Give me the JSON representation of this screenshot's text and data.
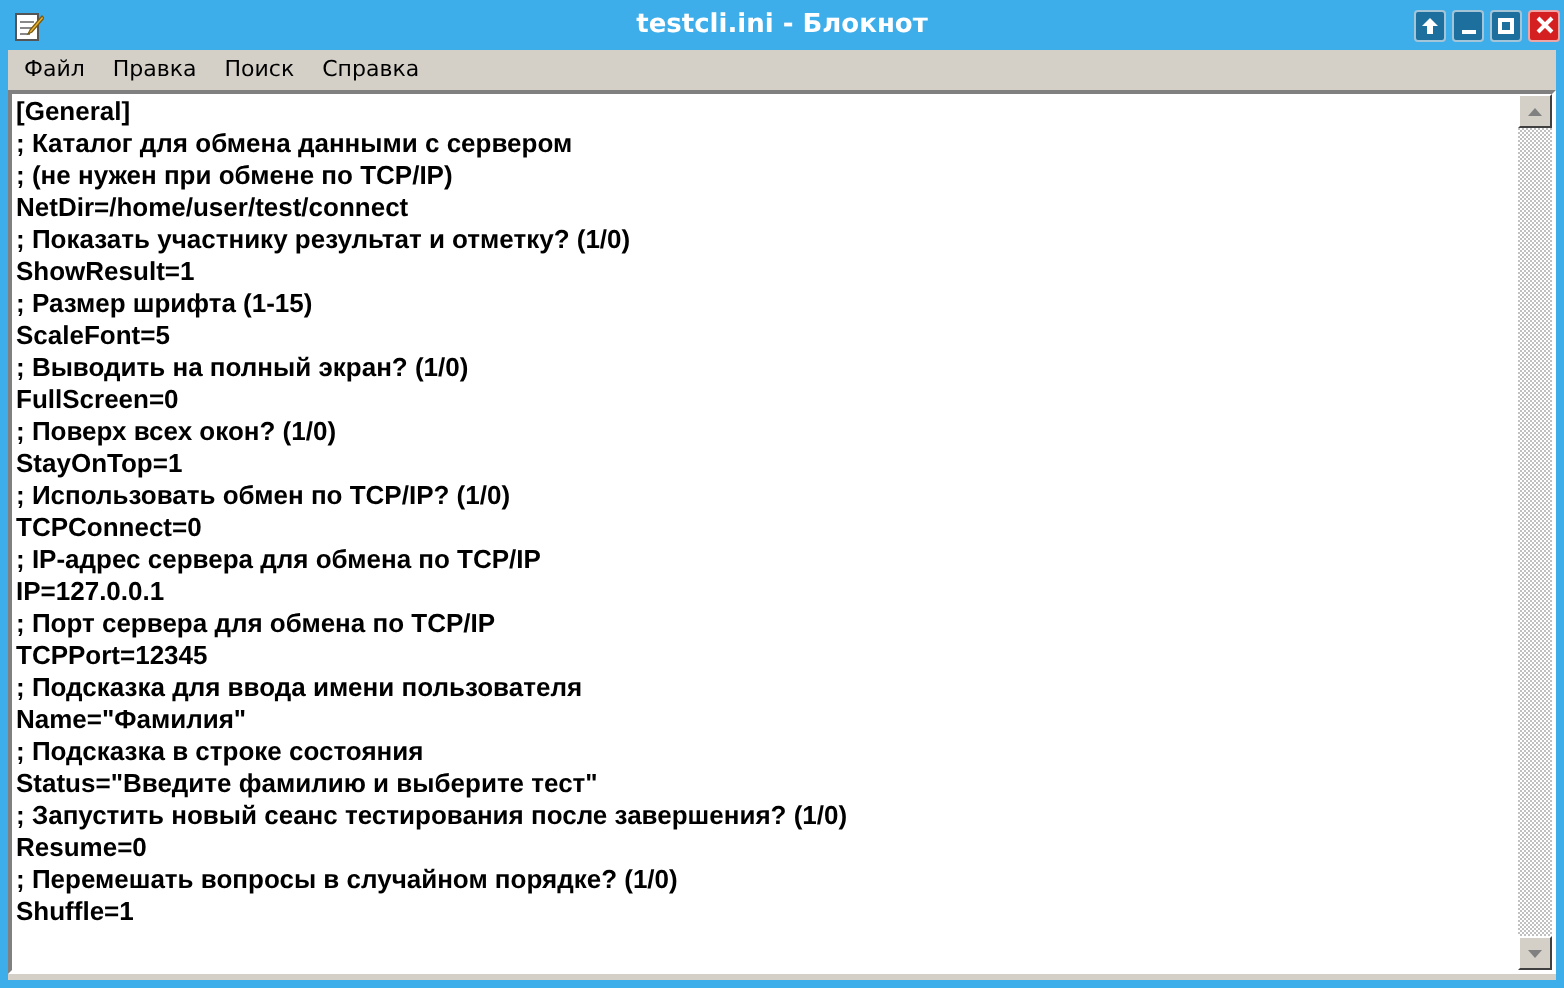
{
  "window": {
    "title": "testcli.ini - Блокнот"
  },
  "menu": [
    "Файл",
    "Правка",
    "Поиск",
    "Справка"
  ],
  "lines": [
    "[General]",
    "; Каталог для обмена данными с сервером",
    "; (не нужен при обмене по TCP/IP)",
    "NetDir=/home/user/test/connect",
    "; Показать участнику результат и отметку? (1/0)",
    "ShowResult=1",
    "; Размер шрифта (1-15)",
    "ScaleFont=5",
    "; Выводить на полный экран? (1/0)",
    "FullScreen=0",
    "; Поверх всех окон? (1/0)",
    "StayOnTop=1",
    "; Использовать обмен по TCP/IP? (1/0)",
    "TCPConnect=0",
    "; IP-адрес сервера для обмена по TCP/IP",
    "IP=127.0.0.1",
    "; Порт сервера для обмена по TCP/IP",
    "TCPPort=12345",
    "; Подсказка для ввода имени пользователя",
    "Name=\"Фамилия\"",
    "; Подсказка в строке состояния",
    "Status=\"Введите фамилию и выберите тест\"",
    "; Запустить новый сеанс тестирования после завершения? (1/0)",
    "Resume=0",
    "; Перемешать вопросы в случайном порядке? (1/0)",
    "Shuffle=1"
  ]
}
